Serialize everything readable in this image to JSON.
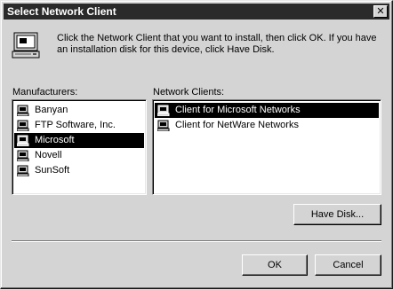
{
  "window": {
    "title": "Select Network Client",
    "close_label": "✕"
  },
  "instructions": "Click the Network Client that you want to install, then click OK. If you have an installation disk for this device, click Have Disk.",
  "manufacturers": {
    "label": "Manufacturers:",
    "items": [
      {
        "label": "Banyan",
        "icon": "network-card-icon"
      },
      {
        "label": "FTP Software, Inc.",
        "icon": "network-card-icon"
      },
      {
        "label": "Microsoft",
        "icon": "network-card-icon",
        "selected": true
      },
      {
        "label": "Novell",
        "icon": "network-card-icon"
      },
      {
        "label": "SunSoft",
        "icon": "network-card-icon"
      }
    ]
  },
  "clients": {
    "label": "Network Clients:",
    "items": [
      {
        "label": "Client for Microsoft Networks",
        "icon": "network-client-icon",
        "selected": true
      },
      {
        "label": "Client for NetWare Networks",
        "icon": "network-client-icon"
      }
    ]
  },
  "buttons": {
    "have_disk": "Have Disk...",
    "ok": "OK",
    "cancel": "Cancel"
  },
  "colors": {
    "dialog_face": "#d4d4d4",
    "titlebar": "#2a2a2a",
    "selection": "#000000"
  }
}
